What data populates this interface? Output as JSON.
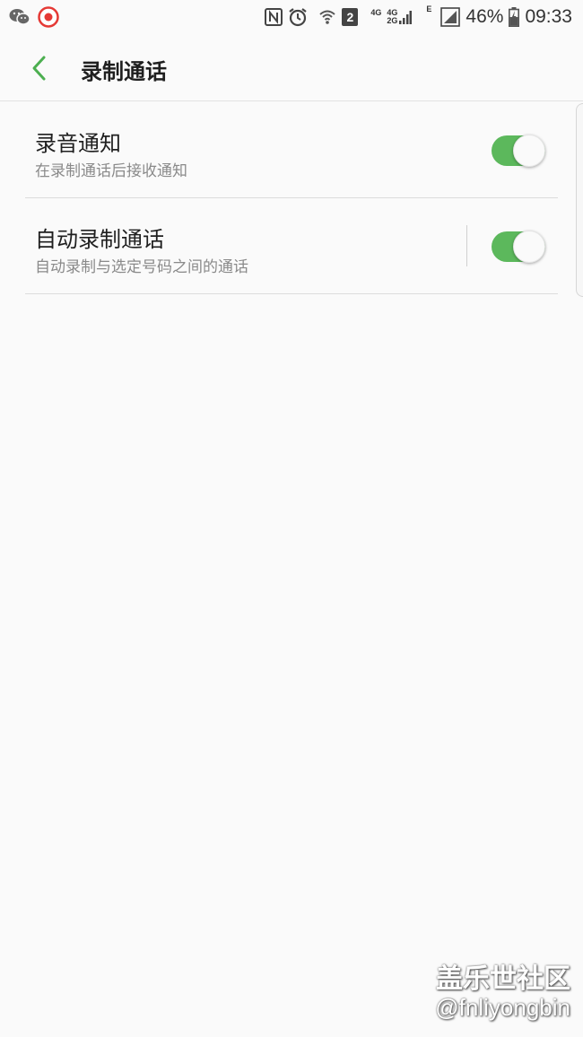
{
  "status_bar": {
    "left_icons": [
      "wechat-icon",
      "recorder-icon"
    ],
    "sim_badge": "2",
    "network_4g_a": "4G",
    "network_4g_b": "4G",
    "network_2g": "2G",
    "network_e": "E",
    "battery": "46%",
    "time": "09:33"
  },
  "header": {
    "title": "录制通话",
    "back_icon": "chevron-left-icon"
  },
  "settings": [
    {
      "title": "录音通知",
      "subtitle": "在录制通话后接收通知",
      "enabled": true
    },
    {
      "title": "自动录制通话",
      "subtitle": "自动录制与选定号码之间的通话",
      "enabled": true
    }
  ],
  "watermark": {
    "brand": "盖乐世社区",
    "user": "@fnliyongbin"
  },
  "colors": {
    "accent": "#5cb85c",
    "background": "#fafafa",
    "back_arrow": "#4caf50"
  }
}
